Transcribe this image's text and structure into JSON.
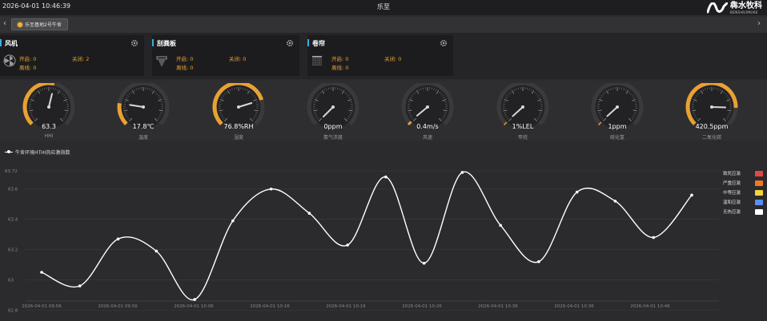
{
  "header": {
    "datetime": "2026-04-01 10:46:39",
    "title": "乐至",
    "brand_name": "犇水牧科",
    "brand_sub": "BENSHUIMUKE"
  },
  "tabs": {
    "prev_arrow": "‹",
    "next_arrow": "›",
    "items": [
      {
        "label": "乐至基地2号牛舍"
      }
    ]
  },
  "devices": [
    {
      "name": "风机",
      "icon": "fan-icon",
      "on_label": "开启:",
      "on_value": "0",
      "off_label": "关闭:",
      "off_value": "2",
      "offline_label": "离线:",
      "offline_value": "0"
    },
    {
      "name": "刮粪板",
      "icon": "scraper-icon",
      "on_label": "开启:",
      "on_value": "0",
      "off_label": "关闭:",
      "off_value": "0",
      "offline_label": "离线:",
      "offline_value": "0"
    },
    {
      "name": "卷帘",
      "icon": "curtain-icon",
      "on_label": "开启:",
      "on_value": "0",
      "off_label": "关闭:",
      "off_value": "0",
      "offline_label": "离线:",
      "offline_value": "0"
    }
  ],
  "gauges": [
    {
      "value": "63.3",
      "label": "HHI",
      "level": 0.55
    },
    {
      "value": "17.8℃",
      "label": "温度",
      "level": 0.2
    },
    {
      "value": "76.8%RH",
      "label": "湿度",
      "level": 0.77
    },
    {
      "value": "0ppm",
      "label": "氨气浓度",
      "level": 0
    },
    {
      "value": "0.4m/s",
      "label": "风速",
      "level": 0.02
    },
    {
      "value": "1%LEL",
      "label": "甲烷",
      "level": 0.01
    },
    {
      "value": "1ppm",
      "label": "硫化氢",
      "level": 0.01
    },
    {
      "value": "420.5ppm",
      "label": "二氧化碳",
      "level": 0.84
    }
  ],
  "colors": {
    "accent": "#2fb0e8",
    "gauge_fill": "#e8a132",
    "status_text": "#e8a132",
    "line": "#ffffff",
    "grid": "#3c3c3e"
  },
  "chart_data": {
    "type": "line",
    "series": [
      {
        "name": "牛舍环境HTHI热应激指数"
      }
    ],
    "x": [
      "09:50",
      "09:53",
      "09:56",
      "09:59",
      "10:02",
      "10:05",
      "10:08",
      "10:11",
      "10:14",
      "10:17",
      "10:20",
      "10:23",
      "10:26",
      "10:29",
      "10:32",
      "10:35",
      "10:38",
      "10:41",
      "10:44",
      "10:47"
    ],
    "y": [
      63.05,
      62.96,
      63.27,
      63.19,
      62.87,
      63.39,
      63.6,
      63.44,
      63.23,
      63.68,
      63.11,
      63.71,
      63.36,
      63.12,
      63.58,
      63.52,
      63.28,
      63.56
    ],
    "x_tick_labels": [
      "2026-04-01 09:56",
      "2026-04-01 09:56",
      "2026-04-01 10:06",
      "2026-04-01 10:16",
      "2026-04-01 10:16",
      "2026-04-01 10:26",
      "2026-04-01 10:36",
      "2026-04-01 10:36",
      "2026-04-01 10:46"
    ],
    "y_ticks": [
      62.8,
      63,
      63.2,
      63.4,
      63.6
    ],
    "y_top_label": "63.72",
    "ylim": [
      62.86,
      63.72
    ],
    "grid": true,
    "legend": [
      {
        "label": "致死应激",
        "color": "#e0474c"
      },
      {
        "label": "严重应激",
        "color": "#f07820"
      },
      {
        "label": "中等应激",
        "color": "#f4d33f"
      },
      {
        "label": "温和应激",
        "color": "#5b8ef0"
      },
      {
        "label": "无热应激",
        "color": "#ffffff"
      }
    ],
    "legend_position": "right"
  }
}
